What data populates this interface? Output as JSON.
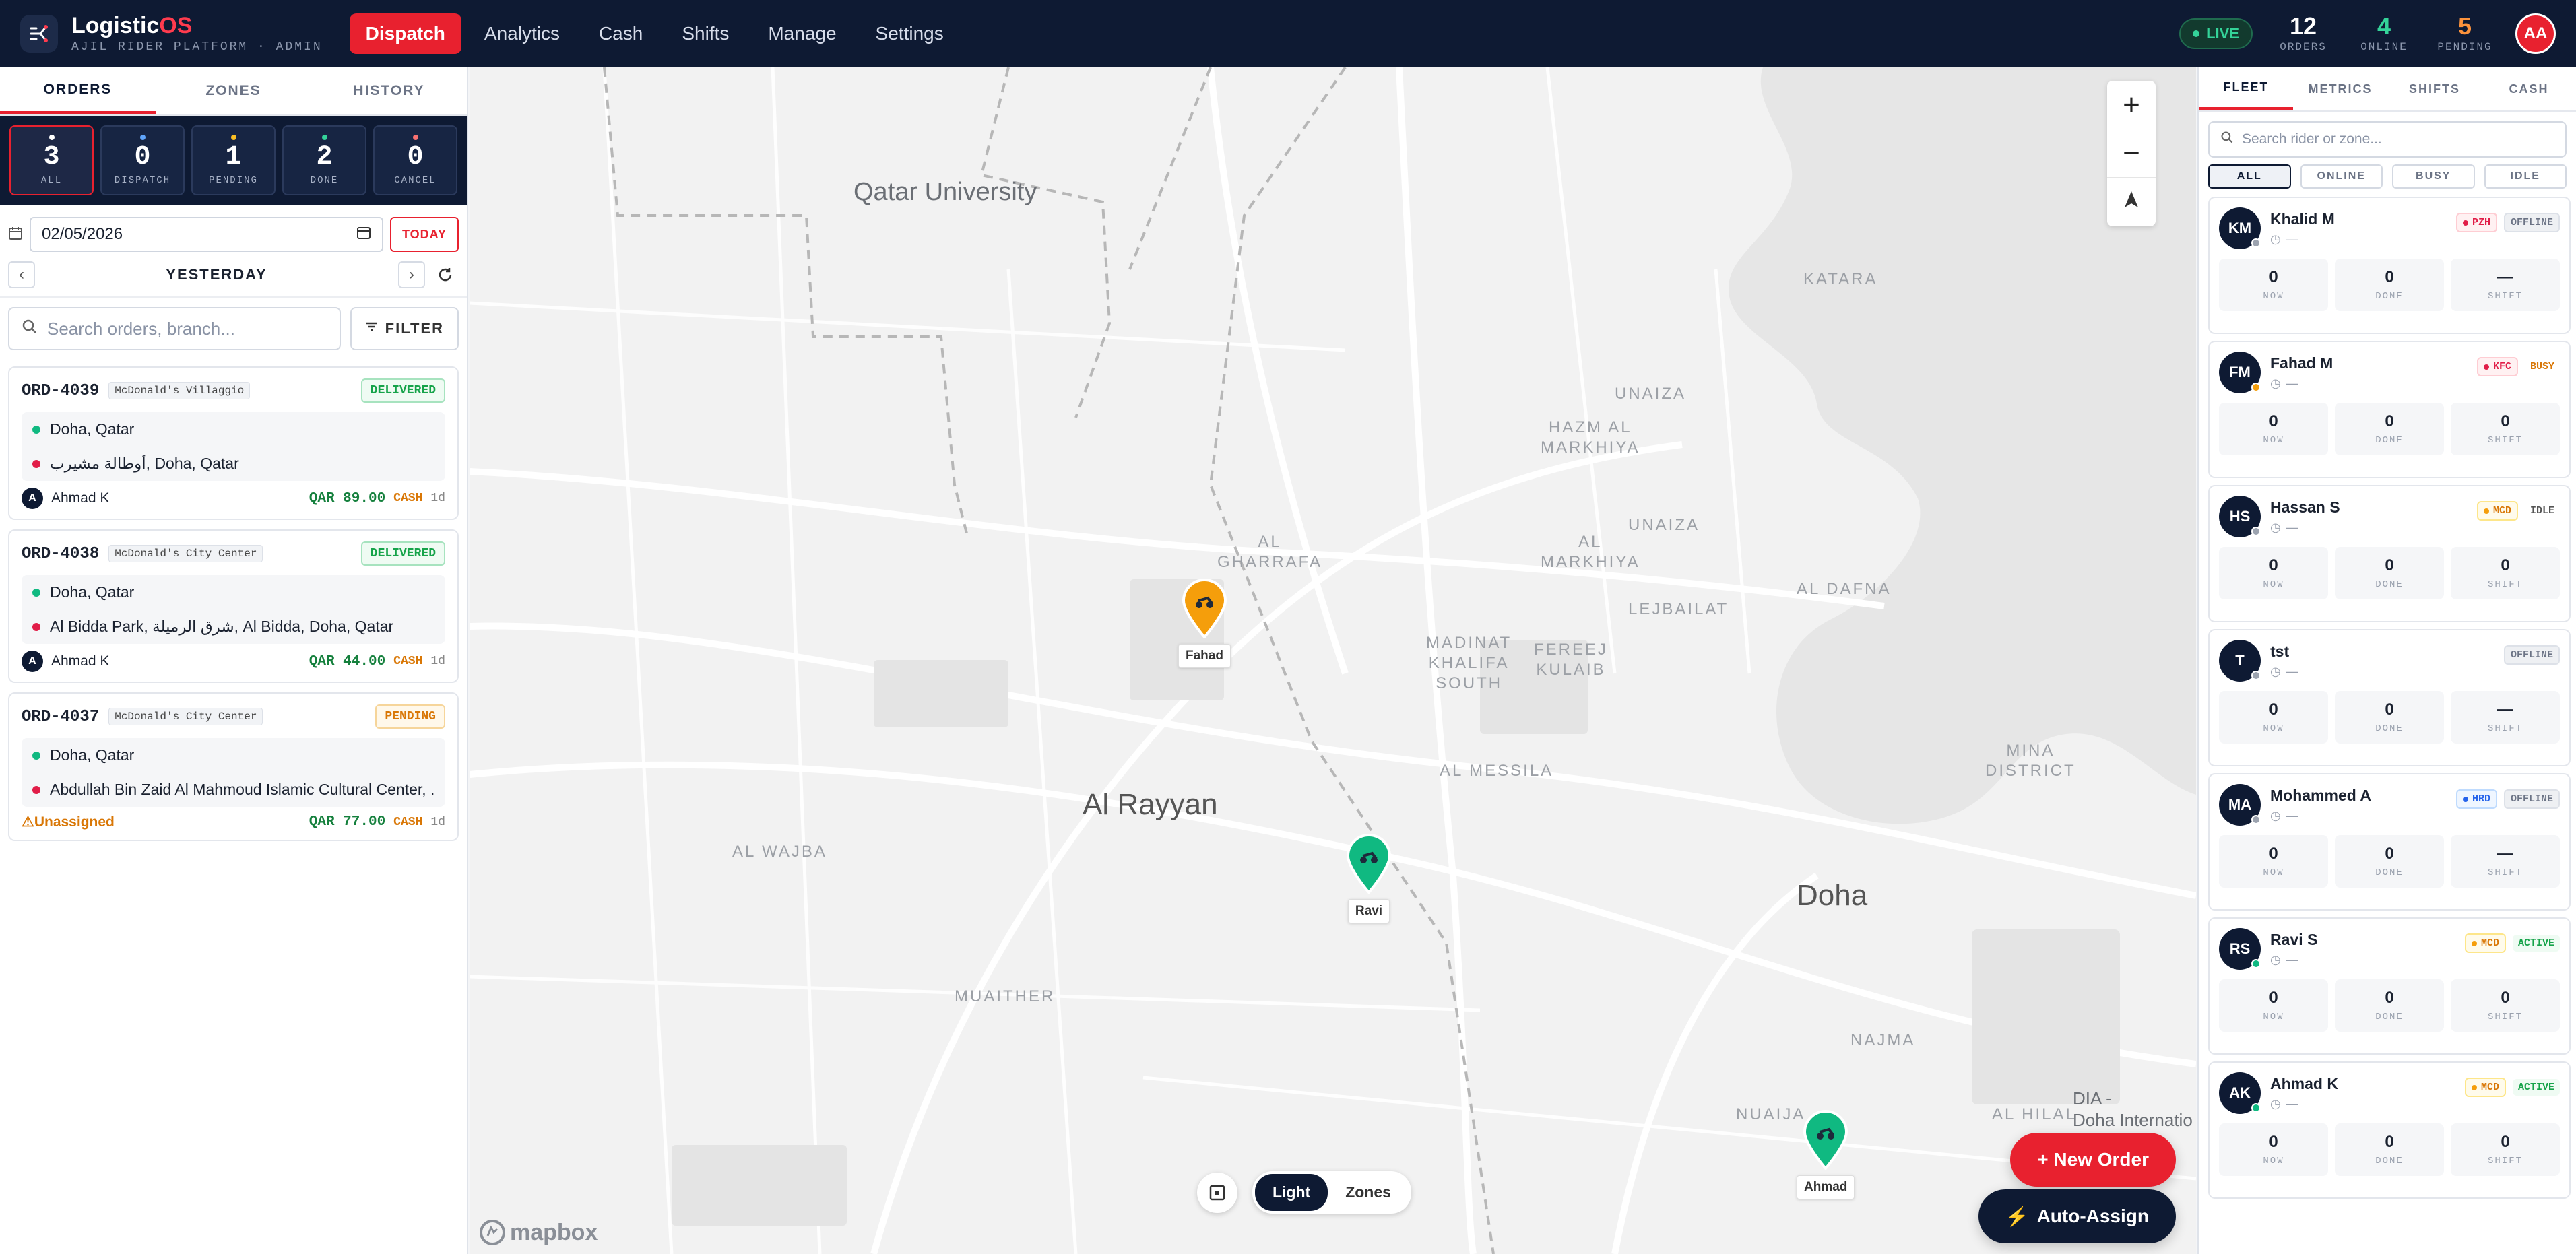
{
  "app": {
    "name_main": "Logistic",
    "name_accent": "OS",
    "subtitle": "AJIL RIDER PLATFORM · ADMIN",
    "avatar": "AA"
  },
  "nav": [
    {
      "label": "Dispatch",
      "active": true
    },
    {
      "label": "Analytics"
    },
    {
      "label": "Cash"
    },
    {
      "label": "Shifts"
    },
    {
      "label": "Manage"
    },
    {
      "label": "Settings"
    }
  ],
  "status": {
    "live": "LIVE",
    "orders": {
      "value": "12",
      "label": "ORDERS"
    },
    "online": {
      "value": "4",
      "label": "ONLINE"
    },
    "pending": {
      "value": "5",
      "label": "PENDING"
    }
  },
  "left": {
    "tabs": [
      "ORDERS",
      "ZONES",
      "HISTORY"
    ],
    "counters": [
      {
        "value": "3",
        "label": "ALL",
        "color": "#ffffff"
      },
      {
        "value": "0",
        "label": "DISPATCH",
        "color": "#60a5fa"
      },
      {
        "value": "1",
        "label": "PENDING",
        "color": "#fbbf24"
      },
      {
        "value": "2",
        "label": "DONE",
        "color": "#34d399"
      },
      {
        "value": "0",
        "label": "CANCEL",
        "color": "#f87171"
      }
    ],
    "date": "02/05/2026",
    "today": "TODAY",
    "day_label": "YESTERDAY",
    "search_placeholder": "Search orders, branch...",
    "filter": "FILTER",
    "orders": [
      {
        "id": "ORD-4039",
        "branch": "McDonald's Villaggio",
        "status": "DELIVERED",
        "from": "Doha, Qatar",
        "to": "أوطالة مشيرب, Doha, Qatar",
        "rider_initial": "A",
        "rider": "Ahmad K",
        "amount": "QAR 89.00",
        "pay": "CASH",
        "age": "1d"
      },
      {
        "id": "ORD-4038",
        "branch": "McDonald's City Center",
        "status": "DELIVERED",
        "from": "Doha, Qatar",
        "to": "Al Bidda Park, شرق الرميلة, Al Bidda, Doha, Qatar",
        "rider_initial": "A",
        "rider": "Ahmad K",
        "amount": "QAR 44.00",
        "pay": "CASH",
        "age": "1d"
      },
      {
        "id": "ORD-4037",
        "branch": "McDonald's City Center",
        "status": "PENDING",
        "from": "Doha, Qatar",
        "to": "Abdullah Bin Zaid Al Mahmoud Islamic Cultural Center, ...",
        "rider": "Unassigned",
        "amount": "QAR 77.00",
        "pay": "CASH",
        "age": "1d"
      }
    ]
  },
  "map": {
    "labels": {
      "qatar_university": "Qatar University",
      "katara": "KATARA",
      "unaiza_top": "UNAIZA",
      "hazm": "HAZM AL\nMARKHIYA",
      "unaiza_mid": "UNAIZA",
      "al_markhiya": "AL\nMARKHIYA",
      "lejbailat": "LEJBAILAT",
      "al_dafna": "AL DAFNA",
      "al_gharrafa": "AL\nGHARRAFA",
      "madinat": "MADINAT\nKHALIFA\nSOUTH",
      "fereej": "FEREEJ\nKULAIB",
      "al_messila": "AL MESSILA",
      "mina": "MINA\nDISTRICT",
      "al_rayyan": "Al Rayyan",
      "al_wajba": "AL WAJBA",
      "doha": "Doha",
      "muaither": "MUAITHER",
      "najma": "NAJMA",
      "al_hilal": "AL HILAL",
      "dia": "DIA -\nDoha Internatio",
      "nuaija": "NUAIJA"
    },
    "riders": [
      {
        "name": "Fahad",
        "color": "#f59e0b"
      },
      {
        "name": "Ravi",
        "color": "#10b981"
      },
      {
        "name": "Ahmad",
        "color": "#10b981"
      }
    ],
    "style_light": "Light",
    "style_zones": "Zones",
    "attribution": "mapbox",
    "new_order": "+ New Order",
    "auto_assign": "Auto-Assign"
  },
  "right": {
    "tabs": [
      "FLEET",
      "METRICS",
      "SHIFTS",
      "CASH"
    ],
    "search_placeholder": "Search rider or zone...",
    "filters": [
      "ALL",
      "ONLINE",
      "BUSY",
      "IDLE"
    ],
    "stat_labels": [
      "NOW",
      "DONE",
      "SHIFT"
    ],
    "riders": [
      {
        "initials": "KM",
        "name": "Khalid M",
        "zone": "PZH",
        "zone_color": "#e11d48",
        "status": "OFFLINE",
        "status_class": "offline",
        "now": "0",
        "done": "0",
        "shift": "—",
        "dot": "#9ca3af"
      },
      {
        "initials": "FM",
        "name": "Fahad M",
        "zone": "KFC",
        "zone_color": "#e11d48",
        "status": "BUSY",
        "status_class": "busy",
        "now": "0",
        "done": "0",
        "shift": "0",
        "dot": "#f59e0b"
      },
      {
        "initials": "HS",
        "name": "Hassan S",
        "zone": "MCD",
        "zone_color": "#f59e0b",
        "status": "IDLE",
        "status_class": "idle",
        "now": "0",
        "done": "0",
        "shift": "0",
        "dot": "#9ca3af"
      },
      {
        "initials": "T",
        "name": "tst",
        "zone": "",
        "zone_color": "",
        "status": "OFFLINE",
        "status_class": "offline",
        "now": "0",
        "done": "0",
        "shift": "—",
        "dot": "#9ca3af"
      },
      {
        "initials": "MA",
        "name": "Mohammed A",
        "zone": "HRD",
        "zone_color": "#2563eb",
        "status": "OFFLINE",
        "status_class": "offline",
        "now": "0",
        "done": "0",
        "shift": "—",
        "dot": "#9ca3af"
      },
      {
        "initials": "RS",
        "name": "Ravi S",
        "zone": "MCD",
        "zone_color": "#f59e0b",
        "status": "ACTIVE",
        "status_class": "active",
        "now": "0",
        "done": "0",
        "shift": "0",
        "dot": "#10b981"
      },
      {
        "initials": "AK",
        "name": "Ahmad K",
        "zone": "MCD",
        "zone_color": "#f59e0b",
        "status": "ACTIVE",
        "status_class": "active",
        "now": "0",
        "done": "0",
        "shift": "0",
        "dot": "#10b981"
      }
    ]
  }
}
